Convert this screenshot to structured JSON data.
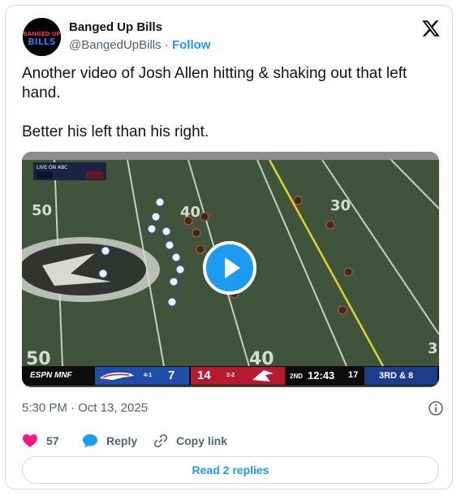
{
  "author": {
    "name": "Banged Up Bills",
    "handle": "@BangedUpBills",
    "separator": " · ",
    "follow_label": "Follow",
    "avatar_text_top": "BANGED UP",
    "avatar_text_bottom": "BILLS"
  },
  "tweet": {
    "text_line1": "Another video of Josh Allen hitting & shaking out that left hand.",
    "text_line2": "Better his left than his right."
  },
  "video": {
    "live_label": "LIVE ON ABC",
    "network": "ESPN MNF",
    "away_record": "4-1",
    "away_score": "7",
    "home_score": "14",
    "home_record": "2-2",
    "quarter": "2ND",
    "clock": "12:43",
    "play_clock": "17",
    "down_distance": "3RD & 8",
    "field_numbers": [
      "50",
      "40",
      "40",
      "30",
      "50",
      "40",
      "3"
    ],
    "colors": {
      "field": "#41583d",
      "away": "#1f4ea8",
      "home": "#b61a30"
    }
  },
  "meta": {
    "timestamp": "5:30 PM · Oct 13, 2025"
  },
  "actions": {
    "like_count": "57",
    "reply_label": "Reply",
    "copy_link_label": "Copy link",
    "read_replies_label": "Read 2 replies"
  },
  "colors": {
    "accent": "#1d9bf0",
    "like": "#f91880",
    "muted": "#536471"
  }
}
